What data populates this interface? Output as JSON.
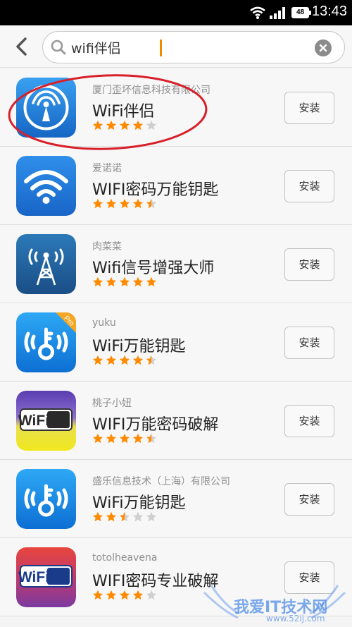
{
  "status_bar": {
    "time": "13:43",
    "battery": "48",
    "icons": [
      "wifi-icon",
      "signal-icon",
      "battery-icon"
    ]
  },
  "search": {
    "query": "wifi伴侣",
    "icons": [
      "back-icon",
      "search-icon",
      "clear-icon"
    ]
  },
  "install_label": "安装",
  "apps": [
    {
      "publisher": "厦门歪坏信息科技有限公司",
      "name": "WiFi伴侣",
      "rating": 4,
      "icon": "wifi-companion-icon"
    },
    {
      "publisher": "爱诺诺",
      "name": "WIFI密码万能钥匙",
      "rating": 4.5,
      "icon": "wifi-signal-icon"
    },
    {
      "publisher": "肉菜菜",
      "name": "Wifi信号增强大师",
      "rating": 5,
      "icon": "signal-tower-icon"
    },
    {
      "publisher": "yuku",
      "name": "WiFi万能钥匙",
      "rating": 4.5,
      "icon": "wifi-key-pro-icon",
      "badge": "Pro"
    },
    {
      "publisher": "桃子小妞",
      "name": "WIFI万能密码破解",
      "rating": 4.5,
      "icon": "wifi-logo-yellow-icon",
      "logo_text": "WiFi"
    },
    {
      "publisher": "盛乐信息技术（上海）有限公司",
      "name": "WiFi万能钥匙",
      "rating": 2.5,
      "icon": "wifi-key-icon"
    },
    {
      "publisher": "totolheavena",
      "name": "WIFI密码专业破解",
      "rating": 4,
      "icon": "wifi-logo-red-icon",
      "logo_text": "WiFi"
    }
  ],
  "highlight": {
    "target": "WiFi伴侣",
    "color": "#d8202a"
  },
  "watermark": {
    "text": "我爱IT技术网",
    "url": "www.52ij.com"
  },
  "colors": {
    "star_on": "#ff8a00",
    "star_off": "#cfcfcf",
    "icon_blue": "#1e7fd8",
    "cursor": "#f08a00"
  }
}
